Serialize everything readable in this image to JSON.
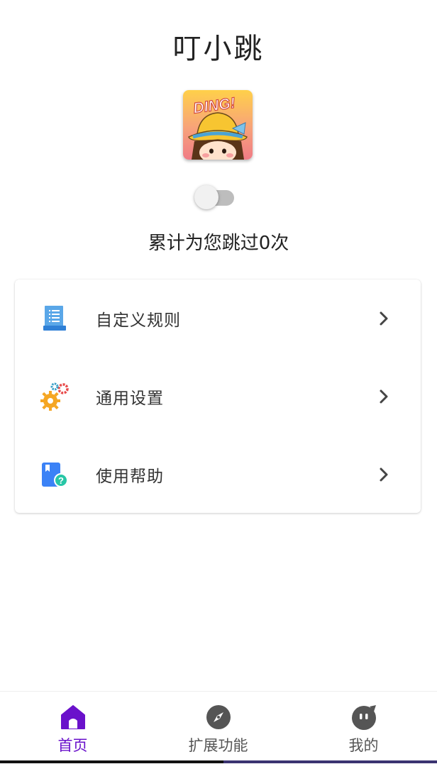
{
  "app": {
    "title": "叮小跳",
    "logo_text": "DING!",
    "skip_counter": "累计为您跳过0次",
    "service_enabled": false
  },
  "menu": {
    "items": [
      {
        "label": "自定义规则",
        "icon": "document-list-icon"
      },
      {
        "label": "通用设置",
        "icon": "gears-icon"
      },
      {
        "label": "使用帮助",
        "icon": "help-book-icon"
      }
    ]
  },
  "tabbar": {
    "tabs": [
      {
        "label": "首页",
        "icon": "home-icon",
        "active": true
      },
      {
        "label": "扩展功能",
        "icon": "compass-icon",
        "active": false
      },
      {
        "label": "我的",
        "icon": "profile-face-icon",
        "active": false
      }
    ]
  },
  "colors": {
    "accent": "#6a11cb",
    "inactive_tab": "#555555",
    "toggle_track": "#bdbdbd"
  }
}
